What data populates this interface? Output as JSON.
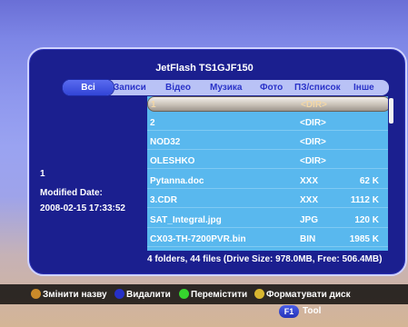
{
  "window": {
    "title": "JetFlash TS1GJF150"
  },
  "tabs": [
    {
      "label": "Всі",
      "active": true
    },
    {
      "label": "Записи",
      "active": false
    },
    {
      "label": "Відео",
      "active": false
    },
    {
      "label": "Музика",
      "active": false
    },
    {
      "label": "Фото",
      "active": false
    },
    {
      "label": "ПЗ/список",
      "active": false
    },
    {
      "label": "Інше",
      "active": false
    }
  ],
  "info": {
    "index": "1",
    "modified_label": "Modified Date:",
    "modified_value": "2008-02-15 17:33:52"
  },
  "files": [
    {
      "name": "1",
      "type": "<DIR>",
      "size": "",
      "selected": true
    },
    {
      "name": "2",
      "type": "<DIR>",
      "size": ""
    },
    {
      "name": "NOD32",
      "type": "<DIR>",
      "size": ""
    },
    {
      "name": "OLESHKO",
      "type": "<DIR>",
      "size": ""
    },
    {
      "name": "Pytanna.doc",
      "type": "XXX",
      "size": "62 K"
    },
    {
      "name": "3.CDR",
      "type": "XXX",
      "size": "1112 K"
    },
    {
      "name": "SAT_Integral.jpg",
      "type": "JPG",
      "size": "120 K"
    },
    {
      "name": "CX03-TH-7200PVR.bin",
      "type": "BIN",
      "size": "1985 K"
    }
  ],
  "summary": "4 folders, 44 files (Drive Size: 978.0MB, Free: 506.4MB)",
  "hints": [
    {
      "color": "#c98a2a",
      "icon": "orange-button-icon",
      "label": "Змінити назву"
    },
    {
      "color": "#2630c6",
      "icon": "blue-button-icon",
      "label": "Видалити"
    },
    {
      "color": "#36d42e",
      "icon": "green-button-icon",
      "label": "Перемістити"
    },
    {
      "color": "#d8b630",
      "icon": "yellow-button-icon",
      "label": "Форматувати диск"
    }
  ],
  "f1": {
    "key": "F1",
    "label": "Tool"
  },
  "colors": {
    "panel": "#1b1f8f",
    "list": "#59b8ee",
    "tab_bar": "#b9c2f6"
  }
}
